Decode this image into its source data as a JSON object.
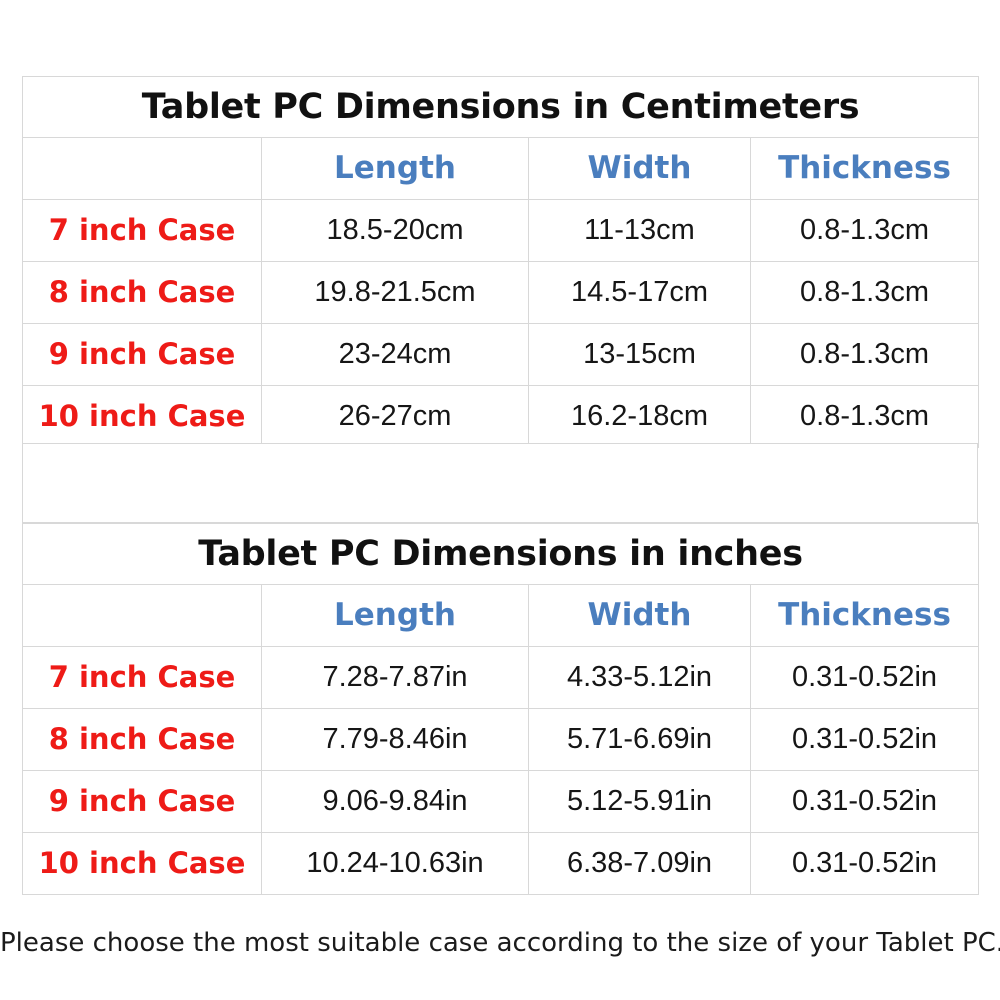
{
  "tables": [
    {
      "title": "Tablet PC Dimensions in Centimeters",
      "headers": [
        "",
        "Length",
        "Width",
        "Thickness"
      ],
      "rows": [
        {
          "case": "7 inch Case",
          "length": "18.5-20cm",
          "width": "11-13cm",
          "thickness": "0.8-1.3cm"
        },
        {
          "case": "8 inch Case",
          "length": "19.8-21.5cm",
          "width": "14.5-17cm",
          "thickness": "0.8-1.3cm"
        },
        {
          "case": "9 inch Case",
          "length": "23-24cm",
          "width": "13-15cm",
          "thickness": "0.8-1.3cm"
        },
        {
          "case": "10 inch Case",
          "length": "26-27cm",
          "width": "16.2-18cm",
          "thickness": "0.8-1.3cm"
        }
      ]
    },
    {
      "title": "Tablet PC Dimensions in inches",
      "headers": [
        "",
        "Length",
        "Width",
        "Thickness"
      ],
      "rows": [
        {
          "case": "7 inch Case",
          "length": "7.28-7.87in",
          "width": "4.33-5.12in",
          "thickness": "0.31-0.52in"
        },
        {
          "case": "8 inch Case",
          "length": "7.79-8.46in",
          "width": "5.71-6.69in",
          "thickness": "0.31-0.52in"
        },
        {
          "case": "9 inch Case",
          "length": "9.06-9.84in",
          "width": "5.12-5.91in",
          "thickness": "0.31-0.52in"
        },
        {
          "case": "10 inch Case",
          "length": "10.24-10.63in",
          "width": "6.38-7.09in",
          "thickness": "0.31-0.52in"
        }
      ]
    }
  ],
  "footer": {
    "note": "Please choose the most suitable case according to the size of your Tablet PC."
  },
  "colors": {
    "case_label": "#ee1b17",
    "column_header": "#4a7ebe",
    "title": "#111111",
    "value": "#161616",
    "border": "#d8d8d8",
    "background": "#ffffff"
  }
}
